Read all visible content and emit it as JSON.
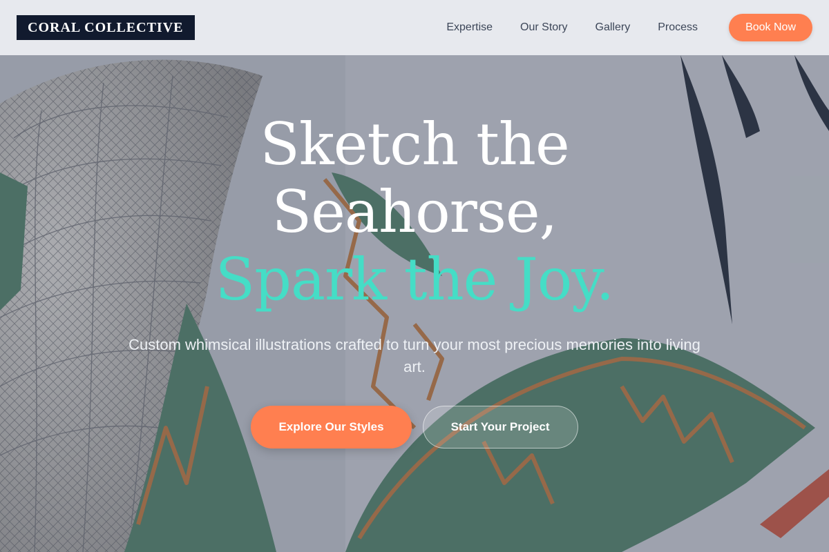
{
  "brand": {
    "name": "CORAL COLLECTIVE"
  },
  "nav": {
    "links": [
      "Expertise",
      "Our Story",
      "Gallery",
      "Process"
    ],
    "cta_label": "Book Now"
  },
  "hero": {
    "title_line1": "Sketch the",
    "title_line2": "Seahorse,",
    "title_accent": "Spark the Joy.",
    "subtitle": "Custom whimsical illustrations crafted to turn your most precious memories into living art.",
    "primary_button": "Explore Our Styles",
    "secondary_button": "Start Your Project"
  },
  "colors": {
    "accent": "#FF7F50",
    "highlight": "#45DDC6",
    "logo_bg": "#111A2E"
  },
  "background": {
    "icon": "illustrated-seahorse-artwork"
  }
}
